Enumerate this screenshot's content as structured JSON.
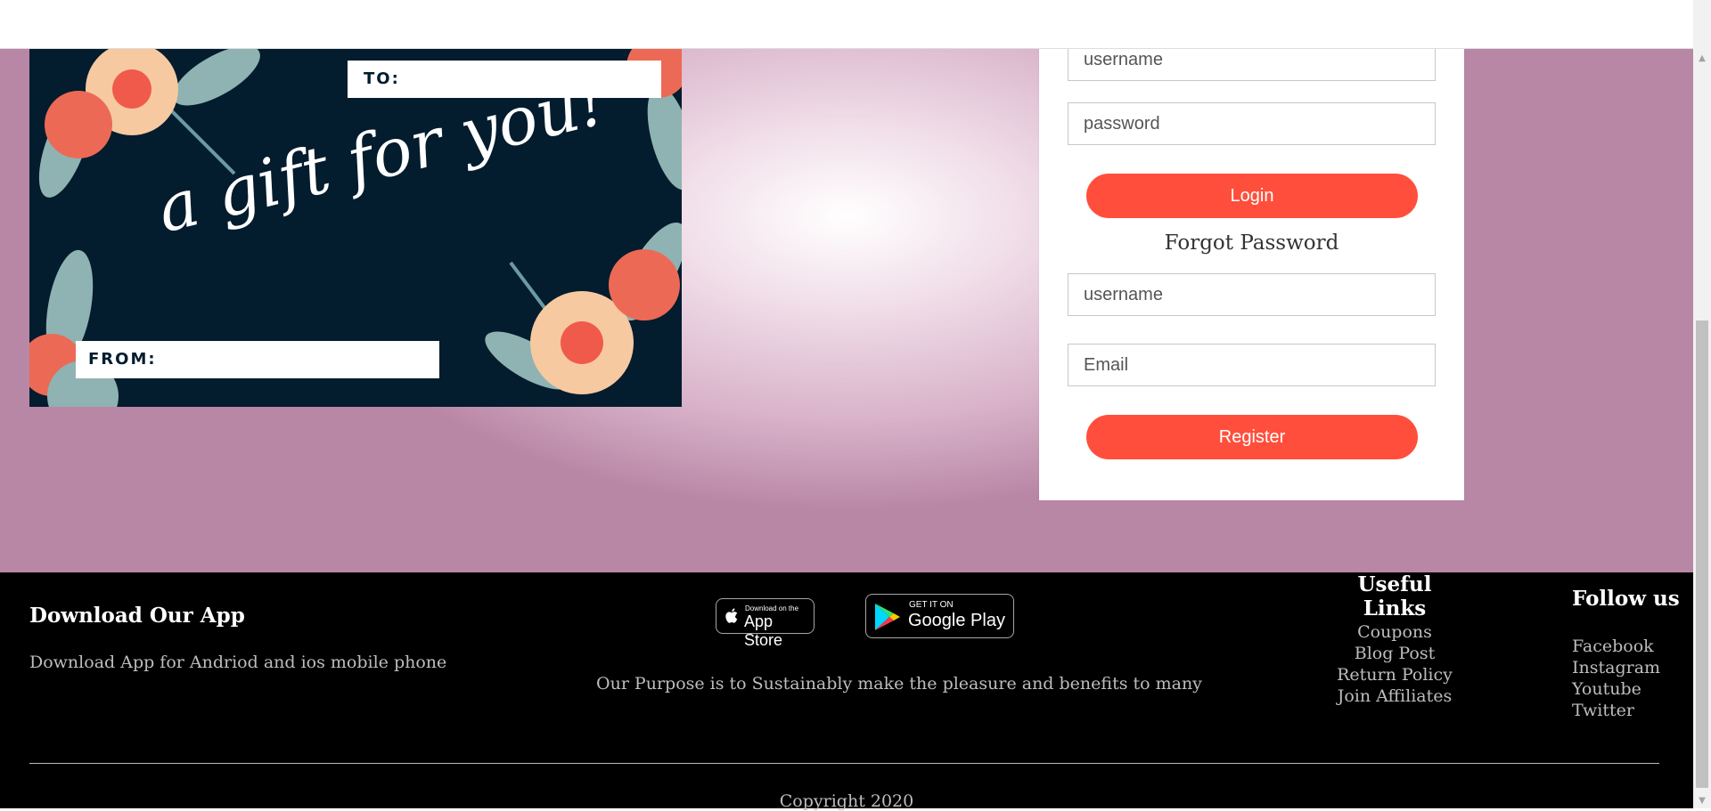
{
  "gift_card": {
    "to_label": "TO:",
    "from_label": "FROM:",
    "headline": "a gift for you!"
  },
  "login_form": {
    "username_placeholder": "username",
    "password_placeholder": "password",
    "login_label": "Login"
  },
  "forgot_form": {
    "title": "Forgot Password",
    "username_placeholder": "username",
    "email_placeholder": "Email",
    "register_label": "Register"
  },
  "footer": {
    "download_title": "Download Our App",
    "download_text": "Download App for Andriod and ios mobile phone",
    "app_store": {
      "small": "Download on the",
      "big": "App Store"
    },
    "google_play": {
      "small": "GET IT ON",
      "big": "Google Play"
    },
    "purpose": "Our Purpose is to Sustainably make the pleasure and benefits to many",
    "useful_links_title": "Useful Links",
    "useful_links": [
      "Coupons",
      "Blog Post",
      "Return Policy",
      "Join Affiliates"
    ],
    "follow_title": "Follow us",
    "follow_links": [
      "Facebook",
      "Instagram",
      "Youtube",
      "Twitter"
    ],
    "copyright": "Copyright 2020"
  },
  "colors": {
    "accent": "#ff4f3c",
    "card_bg": "#031c2e",
    "footer_bg": "#000000"
  },
  "icons": [
    "apple-icon",
    "google-play-icon",
    "scroll-up-icon",
    "scroll-down-icon"
  ]
}
